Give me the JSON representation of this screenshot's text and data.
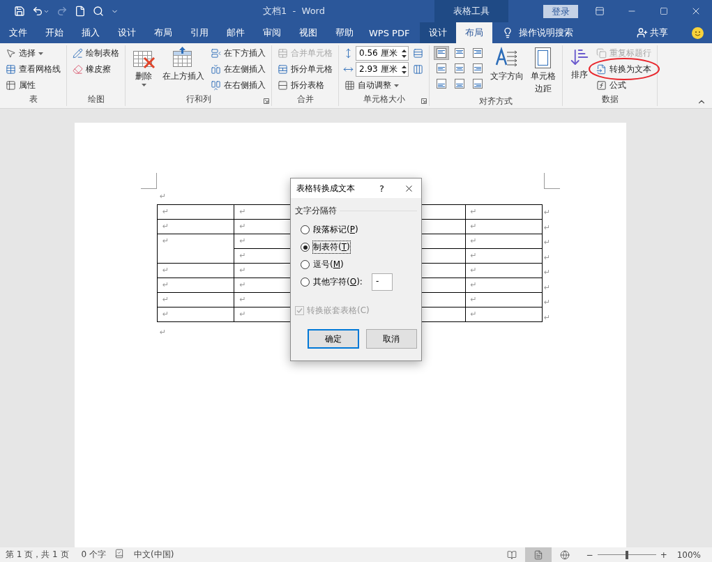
{
  "title_bar": {
    "title": "文档1  -  Word",
    "context_header": "表格工具",
    "sign_in": "登录"
  },
  "tabs": [
    {
      "label": "文件",
      "selected": false,
      "contextual": false
    },
    {
      "label": "开始",
      "selected": false,
      "contextual": false
    },
    {
      "label": "插入",
      "selected": false,
      "contextual": false
    },
    {
      "label": "设计",
      "selected": false,
      "contextual": false
    },
    {
      "label": "布局",
      "selected": false,
      "contextual": false
    },
    {
      "label": "引用",
      "selected": false,
      "contextual": false
    },
    {
      "label": "邮件",
      "selected": false,
      "contextual": false
    },
    {
      "label": "审阅",
      "selected": false,
      "contextual": false
    },
    {
      "label": "视图",
      "selected": false,
      "contextual": false
    },
    {
      "label": "帮助",
      "selected": false,
      "contextual": false
    },
    {
      "label": "WPS PDF",
      "selected": false,
      "contextual": false
    },
    {
      "label": "设计",
      "selected": false,
      "contextual": true
    },
    {
      "label": "布局",
      "selected": true,
      "contextual": true
    }
  ],
  "tell_me": "操作说明搜索",
  "share": "共享",
  "ribbon": {
    "groups": [
      {
        "label": "表",
        "launcher": false,
        "columns": [
          [
            {
              "kind": "small",
              "label": "选择",
              "dropdown": true,
              "disabled": false,
              "circled": false
            },
            {
              "kind": "small",
              "label": "查看网格线",
              "dropdown": false,
              "disabled": false,
              "circled": false
            },
            {
              "kind": "small",
              "label": "属性",
              "dropdown": false,
              "disabled": false,
              "circled": false
            }
          ]
        ]
      },
      {
        "label": "绘图",
        "launcher": false,
        "columns": [
          [
            {
              "kind": "small",
              "label": "绘制表格",
              "dropdown": false,
              "disabled": false,
              "circled": false
            },
            {
              "kind": "small",
              "label": "橡皮擦",
              "dropdown": false,
              "disabled": false,
              "circled": false
            }
          ]
        ]
      },
      {
        "label": "行和列",
        "launcher": true,
        "columns": [
          [
            {
              "kind": "large",
              "lines": [
                "删除"
              ],
              "dropdown": true,
              "disabled": false,
              "circled": false
            }
          ],
          [
            {
              "kind": "large",
              "lines": [
                "在上方插入"
              ],
              "dropdown": false,
              "disabled": false,
              "circled": false
            }
          ],
          [
            {
              "kind": "small",
              "label": "在下方插入",
              "dropdown": false,
              "disabled": false,
              "circled": false
            },
            {
              "kind": "small",
              "label": "在左侧插入",
              "dropdown": false,
              "disabled": false,
              "circled": false
            },
            {
              "kind": "small",
              "label": "在右侧插入",
              "dropdown": false,
              "disabled": false,
              "circled": false
            }
          ]
        ]
      },
      {
        "label": "合并",
        "launcher": false,
        "columns": [
          [
            {
              "kind": "small",
              "label": "合并单元格",
              "dropdown": false,
              "disabled": true,
              "circled": false
            },
            {
              "kind": "small",
              "label": "拆分单元格",
              "dropdown": false,
              "disabled": false,
              "circled": false
            },
            {
              "kind": "small",
              "label": "拆分表格",
              "dropdown": false,
              "disabled": false,
              "circled": false
            }
          ]
        ]
      },
      {
        "label": "单元格大小",
        "launcher": true,
        "columns": [
          [
            {
              "kind": "spinner",
              "value": "0.56 厘米"
            },
            {
              "kind": "spinner",
              "value": "2.93 厘米"
            },
            {
              "kind": "small",
              "label": "自动调整",
              "dropdown": true,
              "disabled": false,
              "circled": false
            }
          ],
          [
            {
              "kind": "icon"
            },
            {
              "kind": "icon"
            }
          ]
        ]
      },
      {
        "label": "对齐方式",
        "launcher": false,
        "columns": [
          [
            {
              "kind": "align",
              "selected": true
            },
            {
              "kind": "align",
              "selected": false
            },
            {
              "kind": "align",
              "selected": false
            }
          ],
          [
            {
              "kind": "align",
              "selected": false
            },
            {
              "kind": "align",
              "selected": false
            },
            {
              "kind": "align",
              "selected": false
            }
          ],
          [
            {
              "kind": "align",
              "selected": false
            },
            {
              "kind": "align",
              "selected": false
            },
            {
              "kind": "align",
              "selected": false
            }
          ],
          [
            {
              "kind": "large",
              "lines": [
                "文字方向"
              ],
              "dropdown": false,
              "disabled": false,
              "circled": false
            }
          ],
          [
            {
              "kind": "large",
              "lines": [
                "单元格",
                "边距"
              ],
              "dropdown": false,
              "disabled": false,
              "circled": false
            }
          ]
        ]
      },
      {
        "label": "数据",
        "launcher": false,
        "columns": [
          [
            {
              "kind": "large",
              "lines": [
                "排序"
              ],
              "dropdown": false,
              "disabled": false,
              "circled": false
            }
          ],
          [
            {
              "kind": "small",
              "label": "重复标题行",
              "dropdown": false,
              "disabled": true,
              "circled": false
            },
            {
              "kind": "small",
              "label": "转换为文本",
              "dropdown": false,
              "disabled": false,
              "circled": true
            },
            {
              "kind": "small",
              "label": "公式",
              "dropdown": false,
              "disabled": false,
              "circled": false
            }
          ]
        ]
      }
    ]
  },
  "document": {
    "paragraph_mark": "↵",
    "rows": [
      {
        "cells": [
          {
            "text": "↵"
          },
          {
            "text": "↵"
          },
          {
            "text": "↵"
          }
        ],
        "end_mark": "↵"
      },
      {
        "cells": [
          {
            "text": "↵"
          },
          {
            "text": "↵"
          },
          {
            "text": "↵"
          }
        ],
        "end_mark": "↵"
      },
      {
        "cells": [
          {
            "text": "↵",
            "rowspan": 2
          },
          {
            "text": "↵"
          },
          {
            "text": "↵"
          }
        ],
        "end_mark": "↵"
      },
      {
        "cells": [
          {
            "text": "↵"
          },
          {
            "text": "↵"
          }
        ],
        "end_mark": "↵"
      },
      {
        "cells": [
          {
            "text": "↵"
          },
          {
            "text": "↵"
          },
          {
            "text": "↵"
          }
        ],
        "end_mark": "↵"
      },
      {
        "cells": [
          {
            "text": "↵"
          },
          {
            "text": "↵"
          },
          {
            "text": "↵"
          }
        ],
        "end_mark": "↵"
      },
      {
        "cells": [
          {
            "text": "↵"
          },
          {
            "text": "↵"
          },
          {
            "text": "↵"
          }
        ],
        "end_mark": "↵"
      },
      {
        "cells": [
          {
            "text": "↵"
          },
          {
            "text": "↵"
          },
          {
            "text": "↵"
          }
        ],
        "end_mark": "↵"
      }
    ],
    "trailing_mark": "↵"
  },
  "dialog": {
    "title": "表格转换成文本",
    "help": "?",
    "group_label": "文字分隔符",
    "options": [
      {
        "before": "段落标记(",
        "key": "P",
        "after": ")",
        "selected": false
      },
      {
        "before": "制表符(",
        "key": "T",
        "after": ")",
        "selected": true
      },
      {
        "before": "逗号(",
        "key": "M",
        "after": ")",
        "selected": false
      },
      {
        "before": "其他字符(",
        "key": "O",
        "after": "):",
        "selected": false,
        "field_value": "-"
      }
    ],
    "checkbox": {
      "label": "转换嵌套表格(C)",
      "checked": true,
      "disabled": true
    },
    "buttons": [
      {
        "label": "确定",
        "default": true
      },
      {
        "label": "取消",
        "default": false
      }
    ]
  },
  "status_bar": {
    "page": "第 1 页，共 1 页",
    "words": "0 个字",
    "language": "中文(中国)",
    "views": [
      {
        "selected": false
      },
      {
        "selected": true
      },
      {
        "selected": false
      }
    ],
    "zoom_out": "−",
    "zoom_in": "+",
    "zoom": {
      "level": 0.5
    },
    "zoom_label": "100%"
  }
}
